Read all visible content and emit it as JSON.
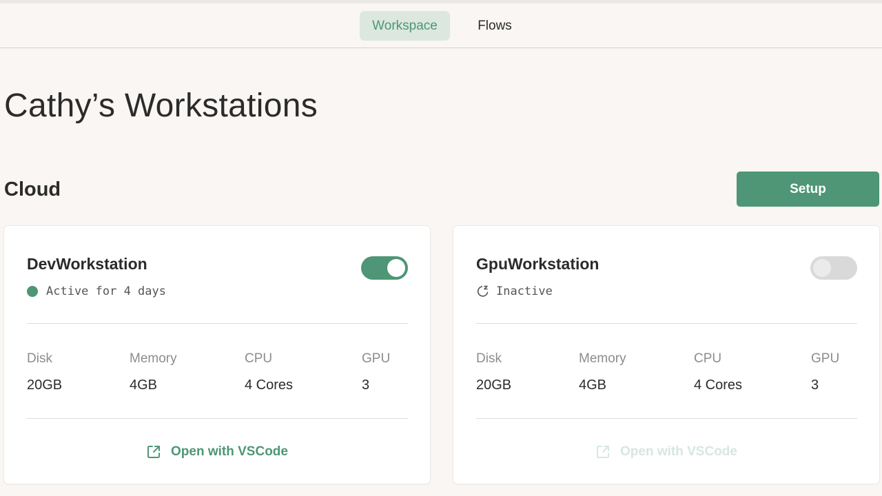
{
  "nav": {
    "tabs": [
      {
        "label": "Workspace",
        "active": true
      },
      {
        "label": "Flows",
        "active": false
      }
    ]
  },
  "page": {
    "title": "Cathy’s Workstations"
  },
  "section": {
    "title": "Cloud",
    "setup_label": "Setup"
  },
  "colors": {
    "accent": "#4e9675",
    "accent_light": "#dbe7df",
    "background": "#f9f6f3"
  },
  "spec_labels": {
    "disk": "Disk",
    "memory": "Memory",
    "cpu": "CPU",
    "gpu": "GPU"
  },
  "workstations": [
    {
      "name": "DevWorkstation",
      "enabled": true,
      "status_icon": "status-dot-icon",
      "status": "Active for 4 days",
      "disk": "20GB",
      "memory": "4GB",
      "cpu": "4 Cores",
      "gpu": "3",
      "open_icon": "external-link-icon",
      "open_label": "Open with VSCode",
      "open_enabled": true
    },
    {
      "name": "GpuWorkstation",
      "enabled": false,
      "status_icon": "sleep-icon",
      "status": "Inactive",
      "disk": "20GB",
      "memory": "4GB",
      "cpu": "4 Cores",
      "gpu": "3",
      "open_icon": "external-link-icon",
      "open_label": "Open with VSCode",
      "open_enabled": false
    }
  ]
}
